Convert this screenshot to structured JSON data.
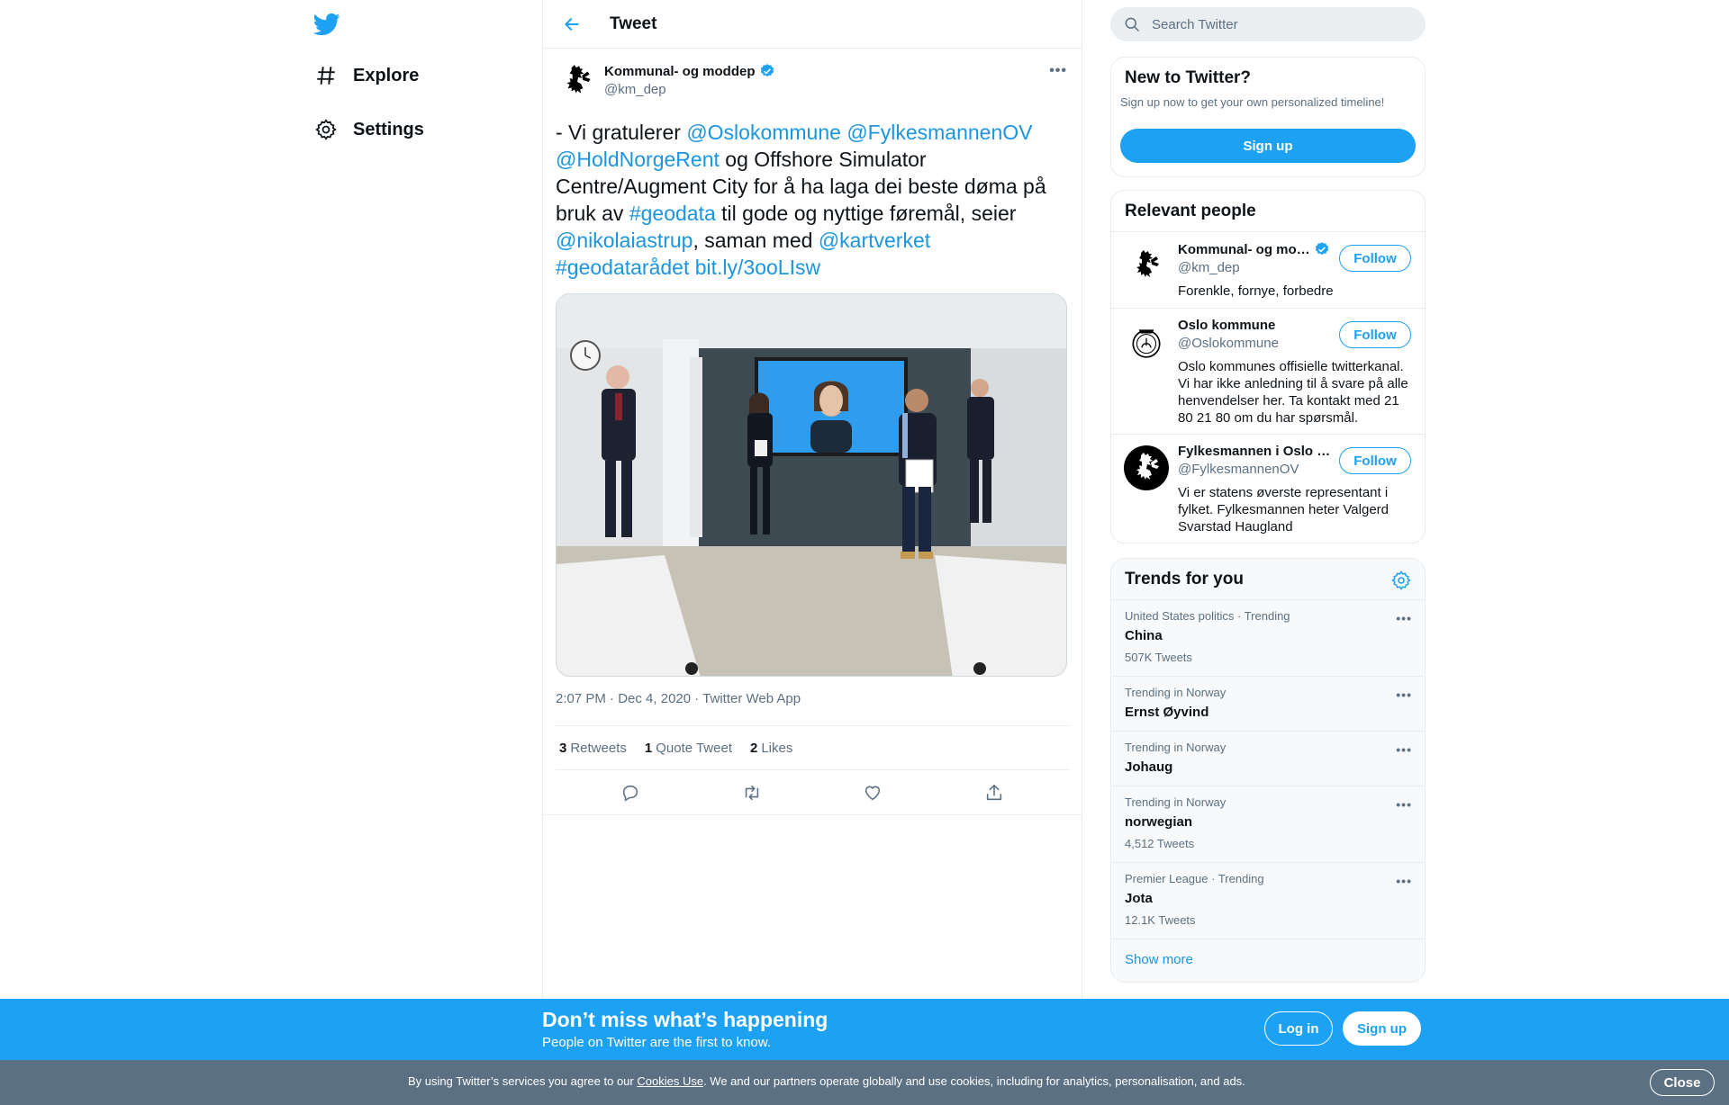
{
  "nav": {
    "explore_label": "Explore",
    "settings_label": "Settings"
  },
  "header": {
    "title": "Tweet"
  },
  "tweet": {
    "author_name": "Kommunal- og moddep",
    "author_handle": "@km_dep",
    "text_parts": {
      "t1": "- Vi gratulerer ",
      "m1": "@Oslokommune",
      "t2": "  ",
      "m2": "@FylkesmannenOV",
      "t3": " ",
      "m3": "@HoldNorgeRent",
      "t4": " og Offshore Simulator Centre/Augment City for å ha laga dei beste døma på bruk av ",
      "h1": "#geodata",
      "t5": " til gode og nyttige føremål, seier ",
      "m4": "@nikolaiastrup",
      "t6": ", saman med ",
      "m5": "@kartverket",
      "t7": " ",
      "h2": "#geodatarådet",
      "t8": " ",
      "l1": "bit.ly/3ooLIsw"
    },
    "time": "2:07 PM",
    "sep1": " · ",
    "date": "Dec 4, 2020",
    "sep2": " · ",
    "source": "Twitter Web App",
    "retweets_count": "3",
    "retweets_label": "Retweets",
    "quote_count": "1",
    "quote_label": "Quote Tweet",
    "likes_count": "2",
    "likes_label": "Likes"
  },
  "search": {
    "placeholder": "Search Twitter"
  },
  "new_card": {
    "title": "New to Twitter?",
    "subtitle": "Sign up now to get your own personalized timeline!",
    "signup_label": "Sign up"
  },
  "people": {
    "title": "Relevant people",
    "items": [
      {
        "name": "Kommunal- og mo…",
        "handle": "@km_dep",
        "bio": "Forenkle, fornye, forbedre",
        "follow": "Follow"
      },
      {
        "name": "Oslo kommune",
        "handle": "@Oslokommune",
        "bio": "Oslo kommunes offisielle twitterkanal. Vi har ikke anledning til å svare på alle henvendelser her. Ta kontakt med 21 80 21 80 om du har spørsmål.",
        "follow": "Follow"
      },
      {
        "name": "Fylkesmannen i Oslo …",
        "handle": "@FylkesmannenOV",
        "bio": "Vi er statens øverste representant i fylket. Fylkesmannen heter Valgerd Svarstad Haugland",
        "follow": "Follow"
      }
    ]
  },
  "trends": {
    "title": "Trends for you",
    "items": [
      {
        "context": "United States politics · Trending",
        "name": "China",
        "count": "507K Tweets"
      },
      {
        "context": "Trending in Norway",
        "name": "Ernst Øyvind",
        "count": ""
      },
      {
        "context": "Trending in Norway",
        "name": "Johaug",
        "count": ""
      },
      {
        "context": "Trending in Norway",
        "name": "norwegian",
        "count": "4,512 Tweets"
      },
      {
        "context": "Premier League · Trending",
        "name": "Jota",
        "count": "12.1K Tweets"
      }
    ],
    "show_more": "Show more"
  },
  "banner": {
    "title": "Don’t miss what’s happening",
    "subtitle": "People on Twitter are the first to know.",
    "login": "Log in",
    "signup": "Sign up"
  },
  "cookie": {
    "text_before": "By using Twitter’s services you agree to our ",
    "link": "Cookies Use",
    "text_after": ". We and our partners operate globally and use cookies, including for analytics, personalisation, and ads.",
    "close": "Close"
  },
  "colors": {
    "accent": "#1da1f2",
    "link": "#1b95e0",
    "cookie_bar": "#5b7083"
  }
}
